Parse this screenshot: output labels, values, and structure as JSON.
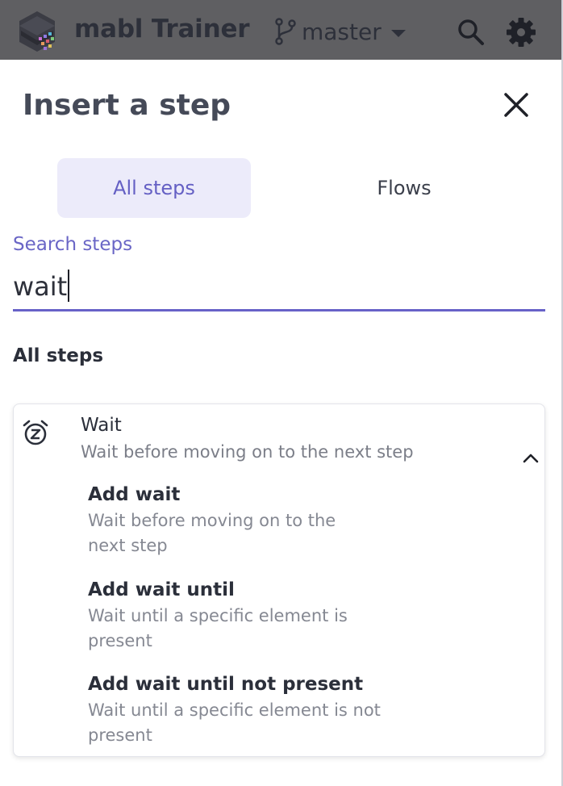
{
  "topbar": {
    "app_title": "mabl Trainer",
    "branch_name": "master",
    "icons": [
      "mabl-logo-icon",
      "git-branch-icon",
      "chevron-down-icon",
      "search-icon",
      "gear-icon"
    ]
  },
  "panel": {
    "heading": "Insert a step",
    "close_icon": "close-icon"
  },
  "tabs": [
    {
      "label": "All steps",
      "selected": true
    },
    {
      "label": "Flows",
      "selected": false
    }
  ],
  "search": {
    "label": "Search steps",
    "value": "wait"
  },
  "results": {
    "section_heading": "All steps",
    "group": {
      "icon": "alarm-snooze-icon",
      "title": "Wait",
      "description": "Wait before moving on to the next step",
      "expanded": true,
      "items": [
        {
          "title": "Add wait",
          "description": "Wait before moving on to the next step"
        },
        {
          "title": "Add wait until",
          "description": "Wait until a specific element is present"
        },
        {
          "title": "Add wait until not present",
          "description": "Wait until a specific element is not present"
        }
      ]
    }
  },
  "colors": {
    "accent": "#6762c8",
    "tab_selected_bg": "#ecebfa",
    "topbar_bg": "#5f5f62"
  }
}
